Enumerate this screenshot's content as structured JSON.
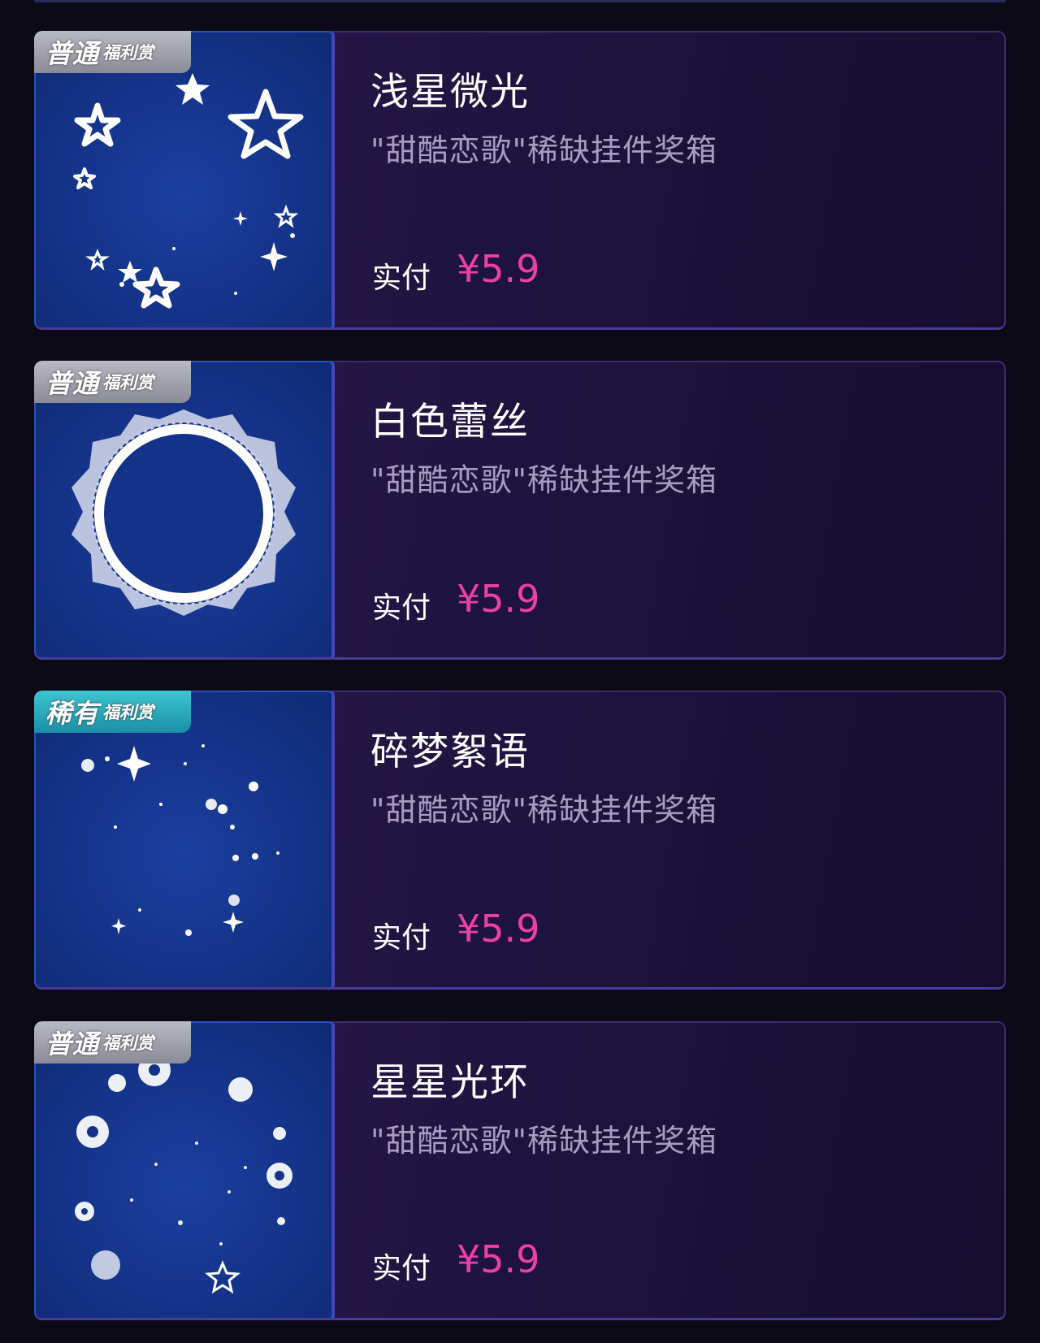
{
  "items": [
    {
      "badge_main": "普通",
      "badge_sub": "福利赏",
      "badge_type": "normal",
      "title": "浅星微光",
      "subtitle": "\"甜酷恋歌\"稀缺挂件奖箱",
      "pay_label": "实付",
      "price": "¥5.9",
      "art_icon": "stars-icon"
    },
    {
      "badge_main": "普通",
      "badge_sub": "福利赏",
      "badge_type": "normal",
      "title": "白色蕾丝",
      "subtitle": "\"甜酷恋歌\"稀缺挂件奖箱",
      "pay_label": "实付",
      "price": "¥5.9",
      "art_icon": "lace-ring-icon"
    },
    {
      "badge_main": "稀有",
      "badge_sub": "福利赏",
      "badge_type": "rare",
      "title": "碎梦絮语",
      "subtitle": "\"甜酷恋歌\"稀缺挂件奖箱",
      "pay_label": "实付",
      "price": "¥5.9",
      "art_icon": "sparkles-icon"
    },
    {
      "badge_main": "普通",
      "badge_sub": "福利赏",
      "badge_type": "normal",
      "title": "星星光环",
      "subtitle": "\"甜酷恋歌\"稀缺挂件奖箱",
      "pay_label": "实付",
      "price": "¥5.9",
      "art_icon": "star-halo-icon"
    }
  ],
  "colors": {
    "price": "#ee3fa8",
    "badge_normal": "#9f9fac",
    "badge_rare": "#2ab0c0",
    "card_bg": "#1f1440",
    "thumb_bg": "#143388"
  }
}
